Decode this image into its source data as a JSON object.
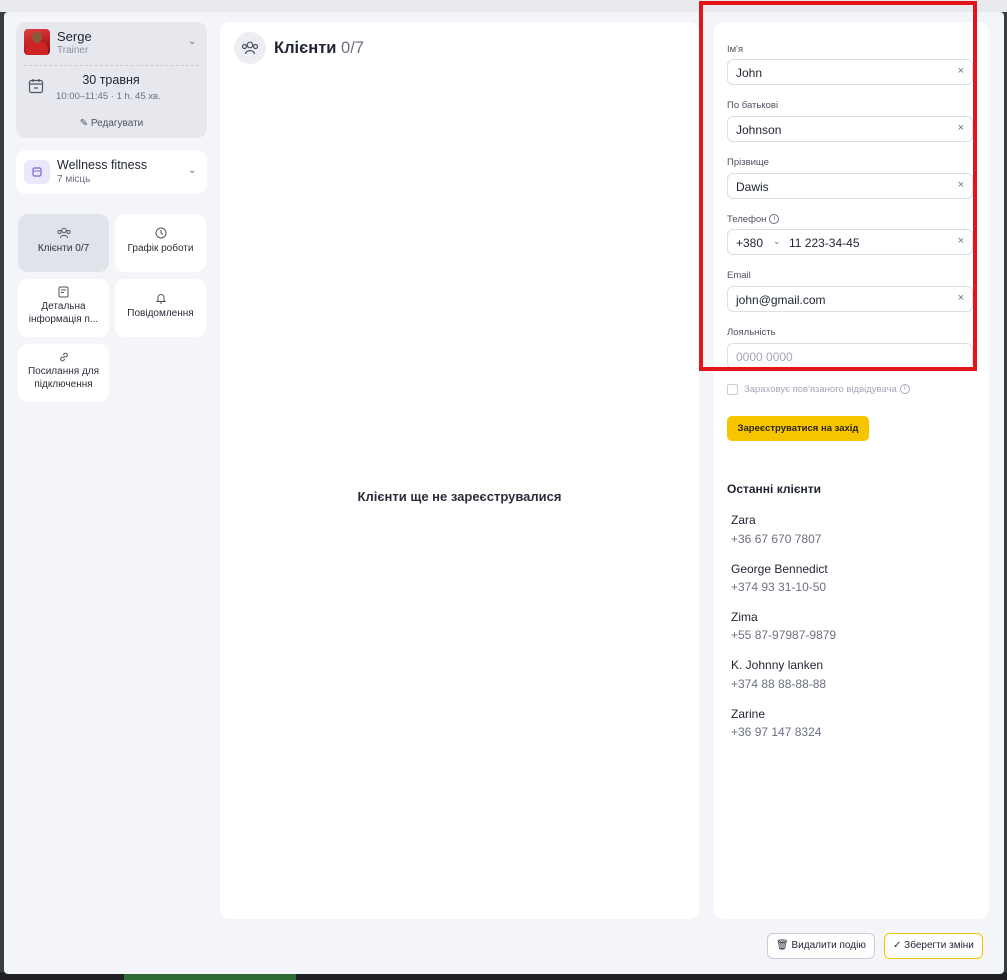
{
  "trainer": {
    "name": "Serge",
    "role": "Trainer"
  },
  "event": {
    "date": "30 травня",
    "time": "10:00–11:45 · 1 h. 45 хв.",
    "edit_label": "Редагувати"
  },
  "room": {
    "name": "Wellness fitness",
    "capacity": "7 місць"
  },
  "menu": {
    "clients": "Клієнти 0/7",
    "schedule": "Графік роботи",
    "details": "Детальна інформація п...",
    "notifications": "Повідомлення",
    "links": "Посилання для підключення"
  },
  "main": {
    "title": "Клієнти",
    "count": "0/7",
    "empty_text": "Клієнти ще не зареєструвалися"
  },
  "form": {
    "first_name": {
      "label": "Ім'я",
      "value": "John"
    },
    "middle_name": {
      "label": "По батькові",
      "value": "Johnson"
    },
    "last_name": {
      "label": "Прізвище",
      "value": "Dawis"
    },
    "phone": {
      "label": "Телефон",
      "code": "+380",
      "value": "11 223-34-45"
    },
    "email": {
      "label": "Email",
      "value": "john@gmail.com"
    },
    "loyalty": {
      "label": "Лояльність",
      "placeholder": "0000 0000"
    },
    "linked_checkbox": "Зараховує пов'язаного відвідувача",
    "register_button": "Зареєструватися на захід"
  },
  "recent": {
    "title": "Останні клієнти",
    "clients": [
      {
        "name": "Zara",
        "phone": "+36 67 670 7807"
      },
      {
        "name": "George Bennedict",
        "phone": "+374 93 31-10-50"
      },
      {
        "name": "Zima",
        "phone": "+55 87-97987-9879"
      },
      {
        "name": "K. Johnny lanken",
        "phone": "+374 88 88-88-88"
      },
      {
        "name": "Zarine",
        "phone": "+36 97 147 8324"
      }
    ]
  },
  "footer": {
    "delete_label": "Видалити подію",
    "save_label": "Зберегти зміни"
  },
  "colors": {
    "accent": "#f6c500",
    "highlight": "#e3151b"
  }
}
